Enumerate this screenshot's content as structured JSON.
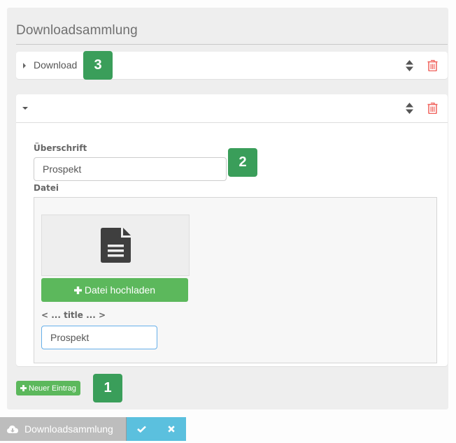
{
  "panel": {
    "title": "Downloadsammlung"
  },
  "entries": [
    {
      "label": "Download",
      "collapsed": true
    },
    {
      "label": "",
      "collapsed": false
    }
  ],
  "form": {
    "heading_label": "Überschrift",
    "heading_value": "Prospekt",
    "file_label": "Datei",
    "upload_button_label": "Datei hochladen",
    "title_label": "< ... title ... >",
    "title_value": "Prospekt"
  },
  "new_entry_button_label": "Neuer Eintrag",
  "badges": {
    "one": "1",
    "two": "2",
    "three": "3"
  },
  "bottom_bar": {
    "title": "Downloadsammlung",
    "confirm_icon": "check-icon",
    "cancel_icon": "close-icon"
  },
  "colors": {
    "success_green": "#5cb85c",
    "badge_green": "#3a9e5a",
    "danger_red": "#f0605a",
    "info_blue": "#5bc0de",
    "bar_gray": "#bdbdbd"
  }
}
